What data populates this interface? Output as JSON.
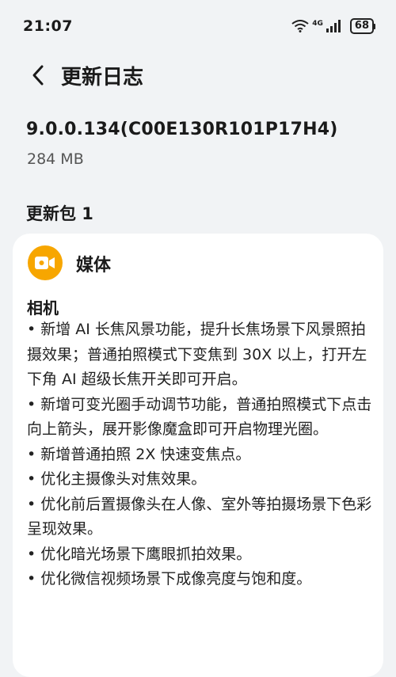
{
  "status_bar": {
    "time": "21:07",
    "network": "4G",
    "battery": "68"
  },
  "header": {
    "title": "更新日志"
  },
  "update": {
    "version": "9.0.0.134(C00E130R101P17H4)",
    "size": "284 MB",
    "package_title": "更新包 1"
  },
  "card": {
    "category": "媒体",
    "section": "相机",
    "notes": [
      "•  新增 AI 长焦风景功能，提升长焦场景下风景照拍摄效果；普通拍照模式下变焦到 30X 以上，打开左下角 AI 超级长焦开关即可开启。",
      "•  新增可变光圈手动调节功能，普通拍照模式下点击向上箭头，展开影像魔盒即可开启物理光圈。",
      "•  新增普通拍照 2X 快速变焦点。",
      "•  优化主摄像头对焦效果。",
      "•  优化前后置摄像头在人像、室外等拍摄场景下色彩呈现效果。",
      "•  优化暗光场景下鹰眼抓拍效果。",
      "•  优化微信视频场景下成像亮度与饱和度。"
    ]
  },
  "colors": {
    "background": "#f1f3f5",
    "card": "#ffffff",
    "media_icon": "#f7a600"
  }
}
